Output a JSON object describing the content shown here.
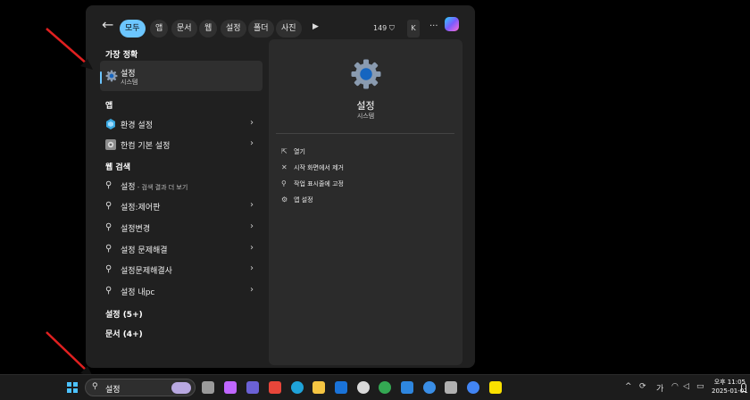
{
  "header": {
    "back_symbol": "←",
    "filters": [
      "모두",
      "앱",
      "문서",
      "웹",
      "설정",
      "폴더",
      "사진"
    ],
    "active_filter": "모두",
    "play_symbol": "▶",
    "count": "149",
    "count_symbol": "⛉",
    "account_initial": "K",
    "more_symbol": "···"
  },
  "left": {
    "best_match_heading": "가장 정확",
    "best_match": {
      "title": "설정",
      "subtitle": "시스템",
      "icon": "gear-icon"
    },
    "apps_heading": "앱",
    "apps": [
      {
        "label": "환경 설정",
        "icon": "control-panel-icon"
      },
      {
        "label": "한컴 기본 설정",
        "icon": "hancom-gear-icon"
      }
    ],
    "web_heading": "웹 검색",
    "web": [
      {
        "label": "설정",
        "suffix": " - 검색 결과 더 보기"
      },
      {
        "label": "설정:제어판",
        "suffix": ""
      },
      {
        "label": "설정변경",
        "suffix": ""
      },
      {
        "label": "설정 문제해결",
        "suffix": ""
      },
      {
        "label": "설정문제해결사",
        "suffix": ""
      },
      {
        "label": "설정 내pc",
        "suffix": ""
      }
    ],
    "more_settings": "설정 (5+)",
    "more_docs": "문서 (4+)",
    "chevron": "›",
    "search_glyph": "⚲"
  },
  "detail": {
    "title": "설정",
    "subtitle": "시스템",
    "actions": [
      {
        "label": "열기",
        "glyph": "⇱",
        "icon": "open-icon"
      },
      {
        "label": "시작 화면에서 제거",
        "glyph": "✕",
        "icon": "unpin-icon"
      },
      {
        "label": "작업 표시줄에 고정",
        "glyph": "⚲",
        "icon": "pin-icon"
      },
      {
        "label": "앱 설정",
        "glyph": "⚙",
        "icon": "app-settings-icon"
      }
    ]
  },
  "taskbar": {
    "search_text": "설정",
    "search_glyph": "⚲",
    "apps": [
      {
        "name": "task-view-icon",
        "color": "#9a9a9a"
      },
      {
        "name": "copilot-app-icon",
        "color": "#c067ff"
      },
      {
        "name": "teams-icon",
        "color": "#6b61d6"
      },
      {
        "name": "app-red-icon",
        "color": "#e8463a"
      },
      {
        "name": "edge-icon",
        "color": "#1fa3d9"
      },
      {
        "name": "file-explorer-icon",
        "color": "#f5c542"
      },
      {
        "name": "outlook-icon",
        "color": "#1a73d9"
      },
      {
        "name": "alien-app-icon",
        "color": "#d9d9d9"
      },
      {
        "name": "chrome-icon",
        "color": "#34a853"
      },
      {
        "name": "store-icon",
        "color": "#2e86de"
      },
      {
        "name": "app-blue-icon",
        "color": "#3a8ee6"
      },
      {
        "name": "photo-app-icon",
        "color": "#b0b0b0"
      },
      {
        "name": "chrome-profile-icon",
        "color": "#4285f4"
      },
      {
        "name": "kakaotalk-icon",
        "color": "#f9e000"
      }
    ],
    "tray": {
      "chevron": "^",
      "ime": "가",
      "time": "오후 11:05",
      "date": "2025-01-01"
    }
  },
  "colors": {
    "accent": "#6cc6ff",
    "panel": "#202020",
    "detail_panel": "#2b2b2b",
    "arrow": "#e02020"
  }
}
